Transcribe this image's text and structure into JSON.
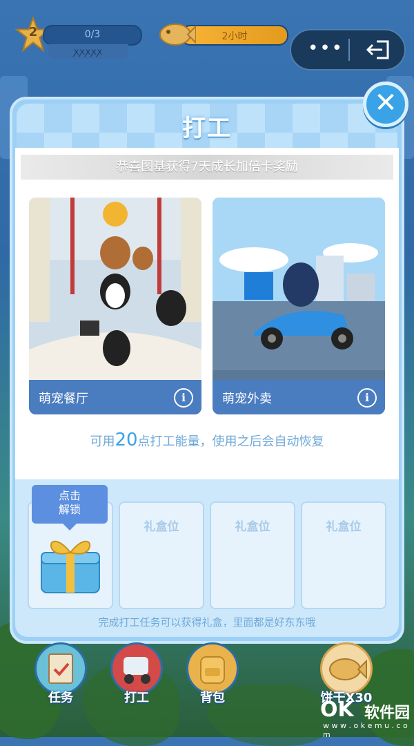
{
  "hud": {
    "level": "2",
    "task_progress": "0/3",
    "ribbon": "ꭗꭗꭗꭗꭗ",
    "timer": "2小时",
    "more_icon": "more-dots-icon",
    "exit_icon": "exit-icon"
  },
  "modal": {
    "title": "打工",
    "close_icon": "close-icon",
    "notice": "恭喜图基获得7天成长加倍卡奖励",
    "cards": [
      {
        "name": "萌宠餐厅"
      },
      {
        "name": "萌宠外卖"
      }
    ],
    "energy": {
      "prefix": "可用",
      "value": "20",
      "suffix": "点打工能量，使用之后会自动恢复"
    },
    "unlock_label": "点击\n解锁",
    "slots": [
      "礼盒位",
      "礼盒位",
      "礼盒位"
    ],
    "footer_tip": "完成打工任务可以获得礼盒，里面都是好东东哦"
  },
  "nav": {
    "items": [
      {
        "label": "任务"
      },
      {
        "label": "打工"
      },
      {
        "label": "背包"
      },
      {
        "label": "饼干X30"
      }
    ]
  },
  "watermark": {
    "ok": "OK",
    "name": "软件园",
    "url": "w w w . o k e m u . c o m"
  },
  "colors": {
    "accent": "#3aa2e6",
    "modal_bg": "#9cd0f6",
    "card_footer": "#4a7cc0",
    "timer": "#f7b336"
  }
}
